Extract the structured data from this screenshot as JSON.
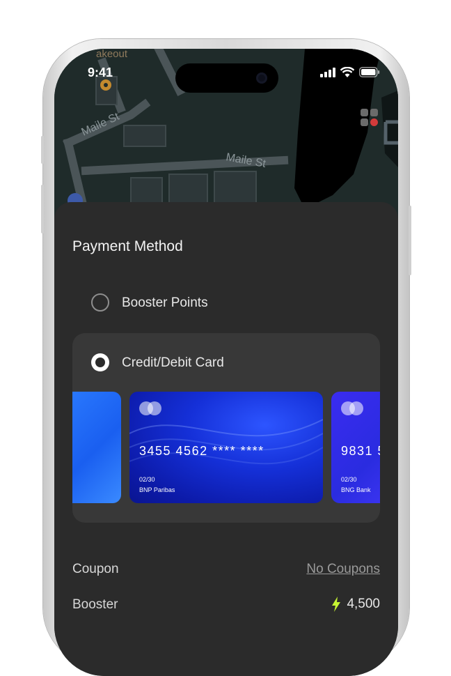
{
  "status_bar": {
    "time": "9:41"
  },
  "map": {
    "street_labels": [
      "Maile St",
      "Maile St"
    ],
    "partial_label": "akeout"
  },
  "payment": {
    "title": "Payment Method",
    "options": [
      {
        "label": "Booster Points",
        "selected": false
      },
      {
        "label": "Credit/Debit Card",
        "selected": true
      }
    ],
    "cards": [
      {
        "number": "",
        "expiry": "",
        "bank": ""
      },
      {
        "number": "3455 4562 **** ****",
        "expiry": "02/30",
        "bank": "BNP Paribas"
      },
      {
        "number": "9831 5",
        "expiry": "02/30",
        "bank": "BNG Bank"
      }
    ]
  },
  "summary": {
    "coupon_label": "Coupon",
    "coupon_value": "No Coupons",
    "booster_label": "Booster",
    "booster_value": "4,500"
  },
  "colors": {
    "sheet_bg": "#2b2b2b",
    "card_box_bg": "#383838",
    "accent_bolt": "#c6f432",
    "card_blue": "#1a2fd6"
  }
}
